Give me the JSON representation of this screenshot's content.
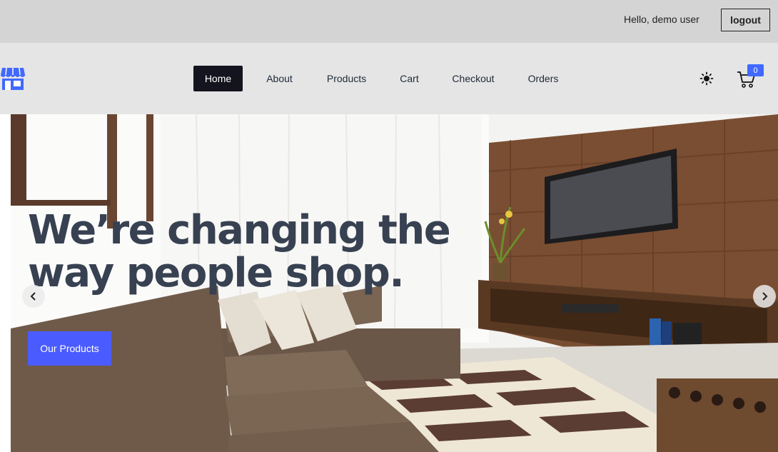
{
  "topbar": {
    "greeting": "Hello, demo user",
    "logout_label": "logout"
  },
  "navbar": {
    "logo_icon": "store-icon",
    "items": [
      {
        "label": "Home",
        "active": true
      },
      {
        "label": "About",
        "active": false
      },
      {
        "label": "Products",
        "active": false
      },
      {
        "label": "Cart",
        "active": false
      },
      {
        "label": "Checkout",
        "active": false
      },
      {
        "label": "Orders",
        "active": false
      }
    ],
    "theme_icon": "sun-icon",
    "cart_icon": "shopping-cart-icon",
    "cart_count": "0"
  },
  "hero": {
    "headline": "We’re changing the way people shop.",
    "cta_label": "Our Products",
    "prev_icon": "chevron-left-icon",
    "next_icon": "chevron-right-icon"
  },
  "colors": {
    "accent": "#4a5cff",
    "badge": "#4169ff",
    "active_nav": "#14141f",
    "topbar_bg": "#d4d4d4",
    "navbar_bg": "#e5e5e5",
    "headline": "#374151"
  }
}
